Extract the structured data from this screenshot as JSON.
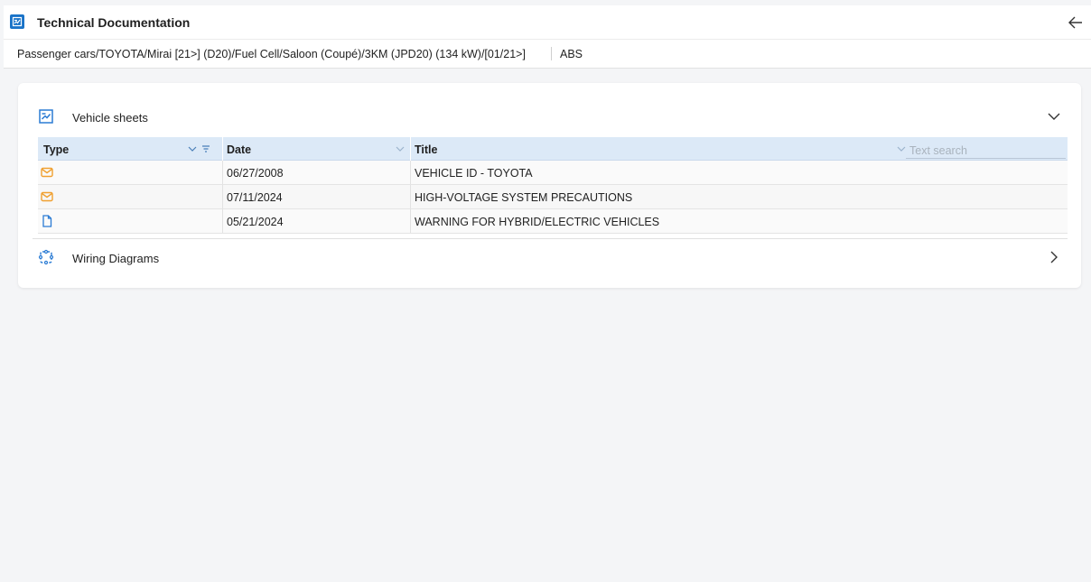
{
  "app": {
    "title": "Technical Documentation",
    "accent_color": "#1a73c8",
    "back_icon": "arrow-left-icon"
  },
  "breadcrumb": {
    "path": "Passenger cars/TOYOTA/Mirai [21>] (D20)/Fuel Cell/Saloon (Coupé)/3KM (JPD20) (134 kW)/[01/21>]",
    "system": "ABS"
  },
  "sections": {
    "vehicle_sheets": {
      "label": "Vehicle sheets",
      "icon": "document-chart-icon",
      "expanded_icon": "chevron-down-icon"
    },
    "wiring_diagrams": {
      "label": "Wiring Diagrams",
      "icon": "circuit-icon",
      "collapsed_icon": "chevron-right-icon"
    }
  },
  "table": {
    "columns": {
      "type": "Type",
      "date": "Date",
      "title": "Title"
    },
    "search_placeholder": "Text search",
    "rows": [
      {
        "type_icon": "envelope-icon",
        "date": "06/27/2008",
        "title": "VEHICLE ID - TOYOTA"
      },
      {
        "type_icon": "envelope-icon",
        "date": "07/11/2024",
        "title": "HIGH-VOLTAGE SYSTEM PRECAUTIONS"
      },
      {
        "type_icon": "document-icon",
        "date": "05/21/2024",
        "title": "WARNING FOR HYBRID/ELECTRIC VEHICLES"
      }
    ]
  },
  "colors": {
    "header_bg": "#dce9f7",
    "envelope_icon": "#f0a030",
    "document_icon": "#2a7bd4"
  }
}
